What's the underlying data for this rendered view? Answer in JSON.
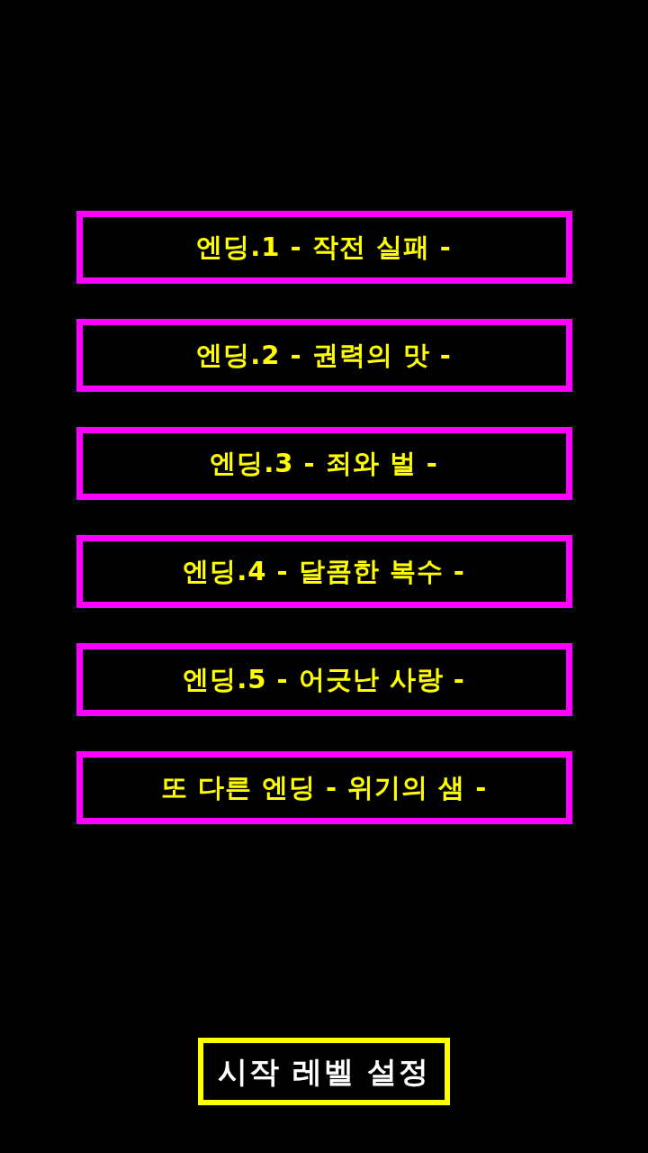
{
  "endings": [
    "엔딩.1 - 작전 실패 -",
    "엔딩.2 - 권력의 맛 -",
    "엔딩.3 - 죄와 벌 -",
    "엔딩.4 - 달콤한 복수 -",
    "엔딩.5 - 어긋난 사랑 -",
    "또 다른 엔딩 - 위기의 샘 -"
  ],
  "start_level_button": "시작 레벨 설정"
}
